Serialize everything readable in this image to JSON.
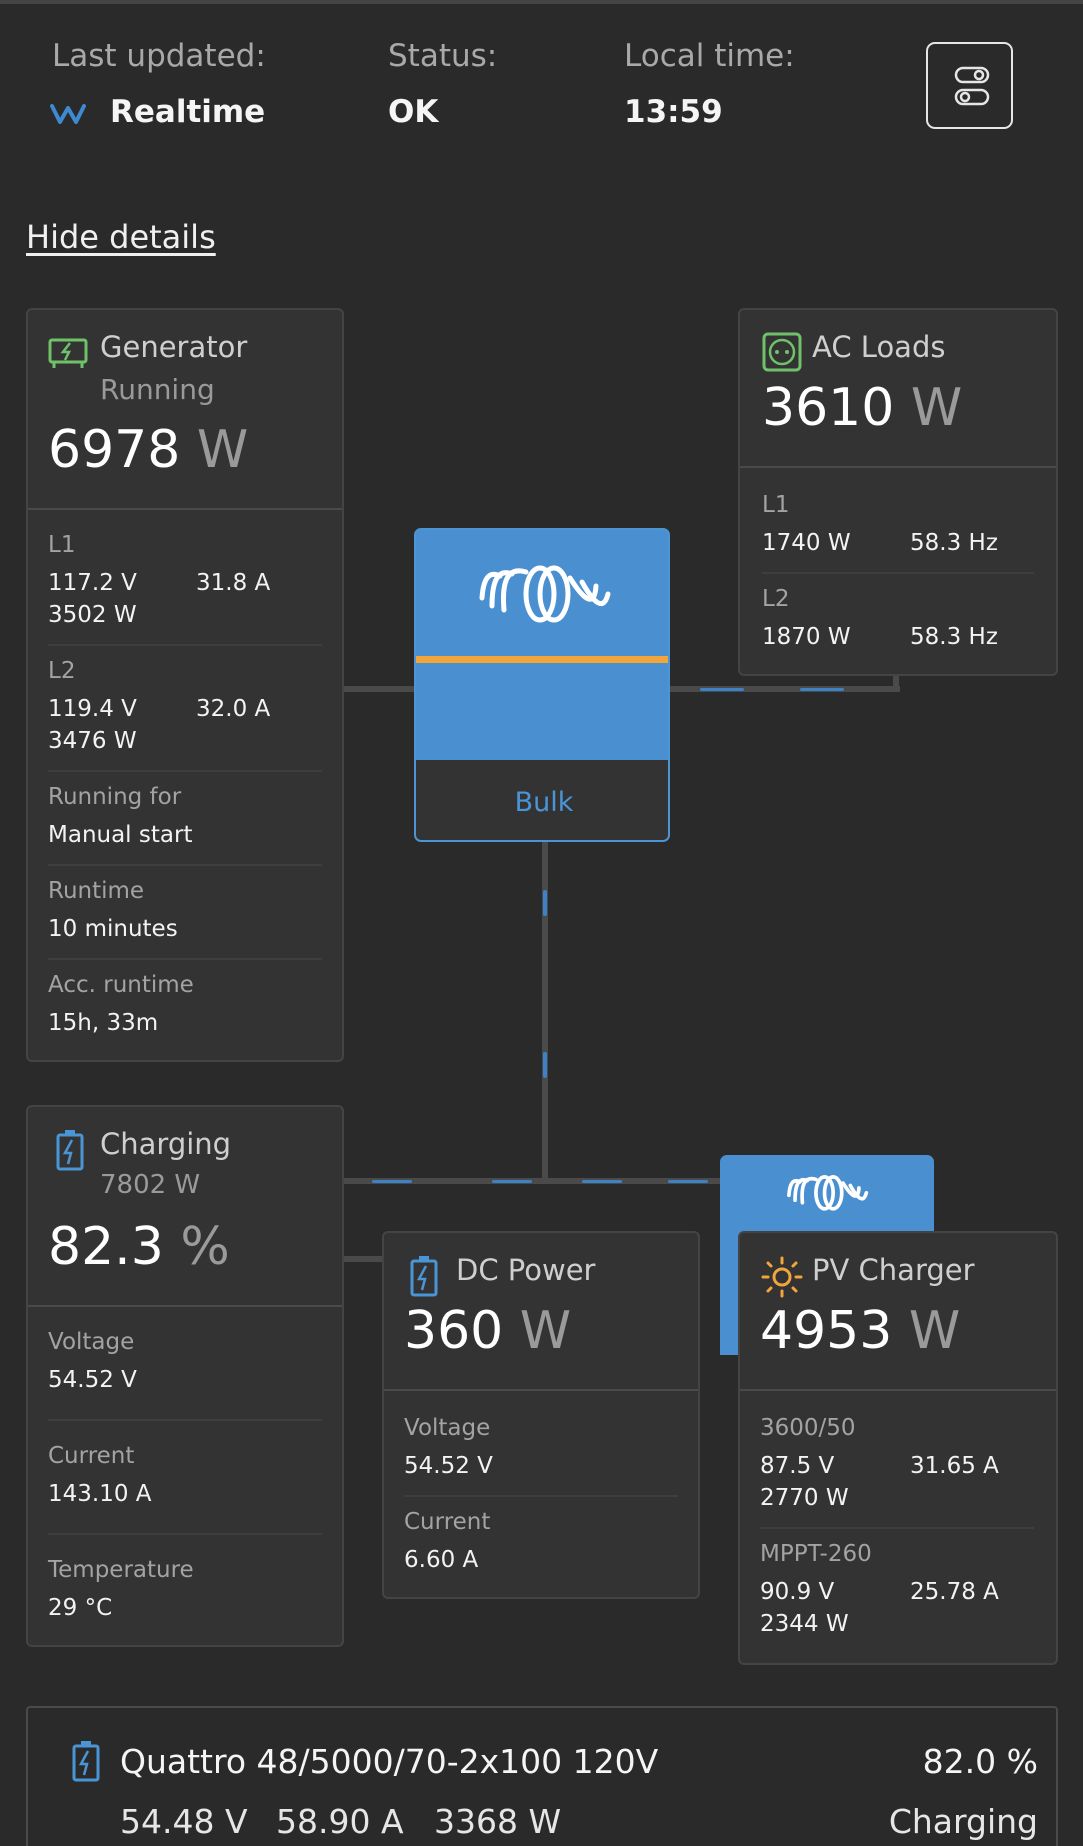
{
  "header": {
    "last_updated_label": "Last updated:",
    "last_updated_value": "Realtime",
    "status_label": "Status:",
    "status_value": "OK",
    "local_time_label": "Local time:",
    "local_time_value": "13:59",
    "hide_details": "Hide details"
  },
  "generator": {
    "title": "Generator",
    "state": "Running",
    "power_value": "6978",
    "power_unit": "W",
    "l1": {
      "label": "L1",
      "voltage": "117.2 V",
      "current": "31.8 A",
      "power": "3502 W"
    },
    "l2": {
      "label": "L2",
      "voltage": "119.4 V",
      "current": "32.0 A",
      "power": "3476 W"
    },
    "running_for_label": "Running for",
    "running_for_value": "Manual start",
    "runtime_label": "Runtime",
    "runtime_value": "10 minutes",
    "acc_runtime_label": "Acc. runtime",
    "acc_runtime_value": "15h, 33m"
  },
  "ac_loads": {
    "title": "AC Loads",
    "power_value": "3610",
    "power_unit": "W",
    "l1": {
      "label": "L1",
      "power": "1740 W",
      "freq": "58.3 Hz"
    },
    "l2": {
      "label": "L2",
      "power": "1870 W",
      "freq": "58.3 Hz"
    }
  },
  "inverter": {
    "state": "Bulk"
  },
  "battery": {
    "title": "Charging",
    "power": "7802 W",
    "soc_value": "82.3",
    "soc_unit": "%",
    "voltage_label": "Voltage",
    "voltage_value": "54.52 V",
    "current_label": "Current",
    "current_value": "143.10 A",
    "temp_label": "Temperature",
    "temp_value": "29 °C"
  },
  "dc_power": {
    "title": "DC Power",
    "power_value": "360",
    "power_unit": "W",
    "voltage_label": "Voltage",
    "voltage_value": "54.52 V",
    "current_label": "Current",
    "current_value": "6.60 A"
  },
  "pv_charger": {
    "title": "PV Charger",
    "power_value": "4953",
    "power_unit": "W",
    "c1": {
      "label": "3600/50",
      "voltage": "87.5 V",
      "current": "31.65 A",
      "power": "2770 W"
    },
    "c2": {
      "label": "MPPT-260",
      "voltage": "90.9 V",
      "current": "25.78 A",
      "power": "2344 W"
    }
  },
  "device": {
    "name": "Quattro 48/5000/70-2x100 120V",
    "percent": "82.0 %",
    "voltage": "54.48 V",
    "current": "58.90 A",
    "power": "3368 W",
    "state": "Charging"
  },
  "colors": {
    "background": "#2a2a2a",
    "card": "#333333",
    "accent_blue": "#4a8fd0",
    "accent_orange": "#f1a53a",
    "generator_green": "#6fc26a",
    "battery_blue": "#4a95d6",
    "pv_orange": "#f1a53a"
  },
  "icons": [
    "realtime-wave-icon",
    "toggle-panels-icon",
    "generator-icon",
    "ac-loads-socket-icon",
    "victron-logo-icon",
    "battery-icon",
    "dc-power-icon",
    "sun-icon"
  ]
}
